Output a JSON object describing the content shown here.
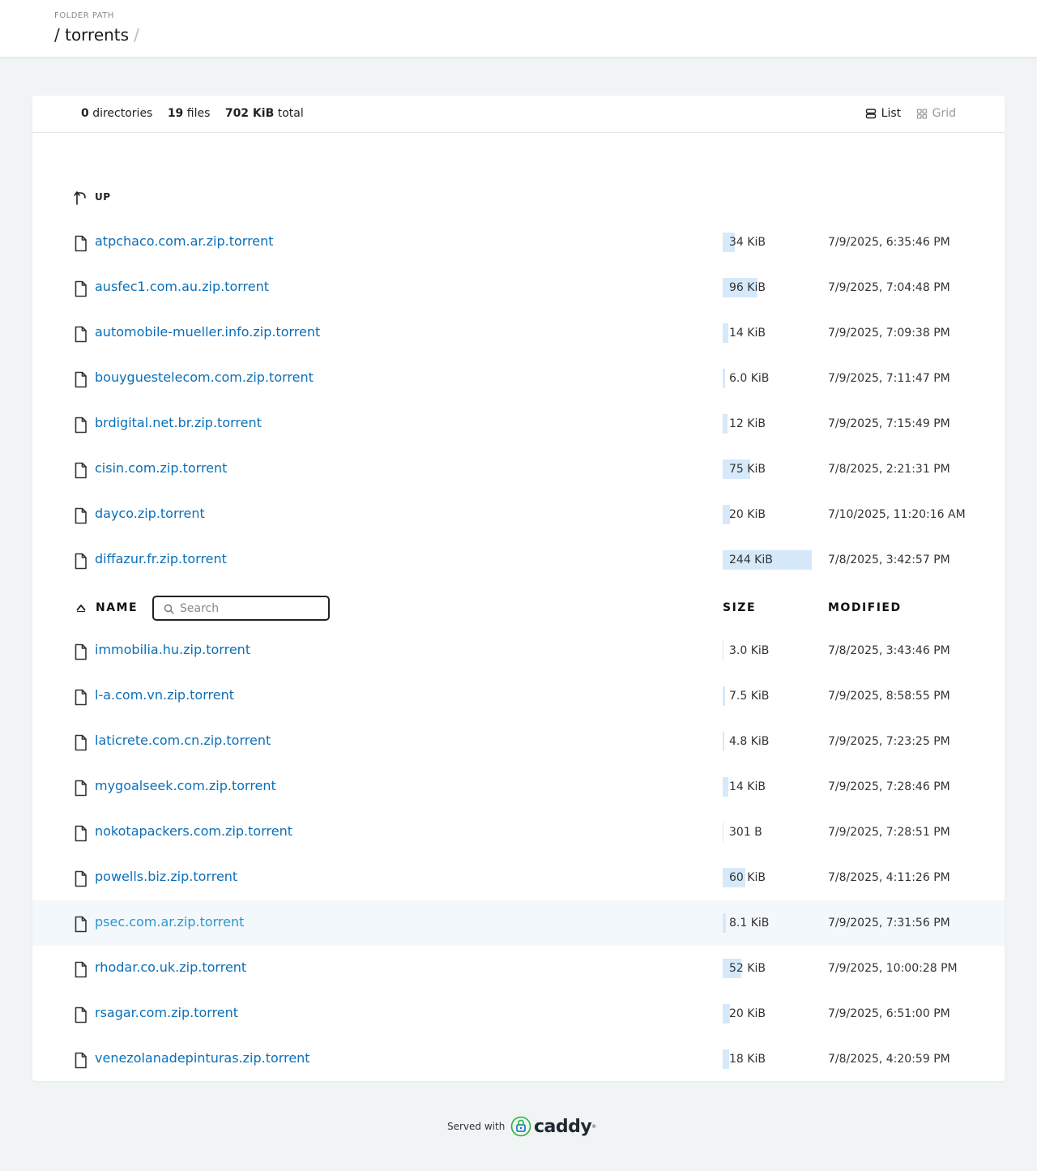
{
  "header": {
    "folder_path_label": "FOLDER PATH",
    "path": "/ torrents",
    "path_sep": "/"
  },
  "summary": {
    "directories_count": "0",
    "directories_label": "directories",
    "files_count": "19",
    "files_label": "files",
    "total_size": "702 KiB",
    "total_label": "total"
  },
  "layout": {
    "list_label": "List",
    "grid_label": "Grid",
    "active": "List"
  },
  "up": {
    "label": "UP",
    "icon": "arrow-up-corner-icon"
  },
  "columns": {
    "name": "NAME",
    "size": "SIZE",
    "modified": "MODIFIED",
    "sort_icon": "sort-ascending-icon"
  },
  "search": {
    "placeholder": "Search",
    "value": ""
  },
  "files_before_header": [
    {
      "name": "atpchaco.com.ar.zip.torrent",
      "size": "34 KiB",
      "size_fraction": 0.14,
      "modified": "7/9/2025, 6:35:46 PM"
    },
    {
      "name": "ausfec1.com.au.zip.torrent",
      "size": "96 KiB",
      "size_fraction": 0.39,
      "modified": "7/9/2025, 7:04:48 PM"
    },
    {
      "name": "automobile-mueller.info.zip.torrent",
      "size": "14 KiB",
      "size_fraction": 0.06,
      "modified": "7/9/2025, 7:09:38 PM"
    },
    {
      "name": "bouyguestelecom.com.zip.torrent",
      "size": "6.0 KiB",
      "size_fraction": 0.025,
      "modified": "7/9/2025, 7:11:47 PM"
    },
    {
      "name": "brdigital.net.br.zip.torrent",
      "size": "12 KiB",
      "size_fraction": 0.05,
      "modified": "7/9/2025, 7:15:49 PM"
    },
    {
      "name": "cisin.com.zip.torrent",
      "size": "75 KiB",
      "size_fraction": 0.31,
      "modified": "7/8/2025, 2:21:31 PM"
    },
    {
      "name": "dayco.zip.torrent",
      "size": "20 KiB",
      "size_fraction": 0.08,
      "modified": "7/10/2025, 11:20:16 AM"
    },
    {
      "name": "diffazur.fr.zip.torrent",
      "size": "244 KiB",
      "size_fraction": 1.0,
      "modified": "7/8/2025, 3:42:57 PM"
    }
  ],
  "files_after_header": [
    {
      "name": "immobilia.hu.zip.torrent",
      "size": "3.0 KiB",
      "size_fraction": 0.012,
      "modified": "7/8/2025, 3:43:46 PM"
    },
    {
      "name": "l-a.com.vn.zip.torrent",
      "size": "7.5 KiB",
      "size_fraction": 0.03,
      "modified": "7/9/2025, 8:58:55 PM"
    },
    {
      "name": "laticrete.com.cn.zip.torrent",
      "size": "4.8 KiB",
      "size_fraction": 0.02,
      "modified": "7/9/2025, 7:23:25 PM"
    },
    {
      "name": "mygoalseek.com.zip.torrent",
      "size": "14 KiB",
      "size_fraction": 0.06,
      "modified": "7/9/2025, 7:28:46 PM"
    },
    {
      "name": "nokotapackers.com.zip.torrent",
      "size": "301 B",
      "size_fraction": 0.004,
      "modified": "7/9/2025, 7:28:51 PM"
    },
    {
      "name": "powells.biz.zip.torrent",
      "size": "60 KiB",
      "size_fraction": 0.25,
      "modified": "7/8/2025, 4:11:26 PM"
    },
    {
      "name": "psec.com.ar.zip.torrent",
      "size": "8.1 KiB",
      "size_fraction": 0.033,
      "modified": "7/9/2025, 7:31:56 PM",
      "hovered": true
    },
    {
      "name": "rhodar.co.uk.zip.torrent",
      "size": "52 KiB",
      "size_fraction": 0.21,
      "modified": "7/9/2025, 10:00:28 PM"
    },
    {
      "name": "rsagar.com.zip.torrent",
      "size": "20 KiB",
      "size_fraction": 0.08,
      "modified": "7/9/2025, 6:51:00 PM"
    },
    {
      "name": "venezolanadepinturas.zip.torrent",
      "size": "18 KiB",
      "size_fraction": 0.075,
      "modified": "7/8/2025, 4:20:59 PM"
    }
  ],
  "footer": {
    "served_with": "Served with",
    "brand": "caddy",
    "brand_mark": "®",
    "logo_icon": "caddy-lock-logo-icon"
  },
  "colors": {
    "link": "#0b6fb8",
    "link_hover": "#2b97cf",
    "size_bar": "#d6e9fb",
    "page_bg": "#f1f4f5",
    "hover_row": "#f3f8fc",
    "caddy_green": "#22b638",
    "caddy_blue": "#0b6fb8"
  }
}
